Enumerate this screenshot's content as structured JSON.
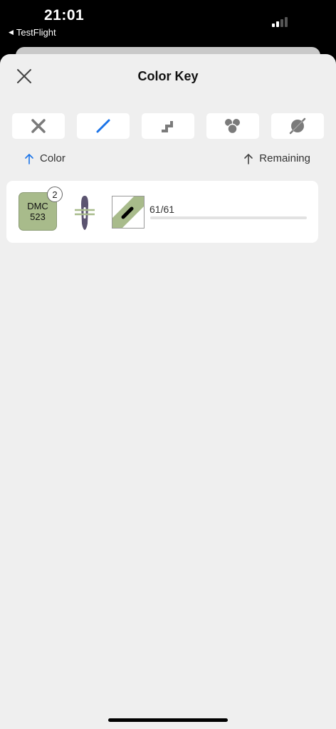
{
  "status_bar": {
    "time": "21:01",
    "back_app": "TestFlight",
    "signal_bars_filled": 2,
    "signal_bars_total": 4
  },
  "header": {
    "title": "Color Key",
    "close_icon": "close-icon"
  },
  "stitch_modes": [
    {
      "icon": "full-cross-stitch-icon",
      "selected": false
    },
    {
      "icon": "back-stitch-icon",
      "selected": true
    },
    {
      "icon": "stair-stitch-icon",
      "selected": false
    },
    {
      "icon": "french-knots-icon",
      "selected": false
    },
    {
      "icon": "bead-icon",
      "selected": false
    }
  ],
  "sort": {
    "color_label": "Color",
    "color_active": true,
    "remaining_label": "Remaining",
    "remaining_active": false
  },
  "threads": [
    {
      "brand": "DMC",
      "code": "523",
      "swatch_color": "#a8bb8b",
      "strands": "2",
      "count_text": "61/61",
      "progress_fraction": 1.0
    }
  ],
  "colors": {
    "accent": "#1a73e8",
    "sheet_background": "#efefef",
    "card_background": "#ffffff",
    "icon_gray": "#7b7b7b"
  }
}
